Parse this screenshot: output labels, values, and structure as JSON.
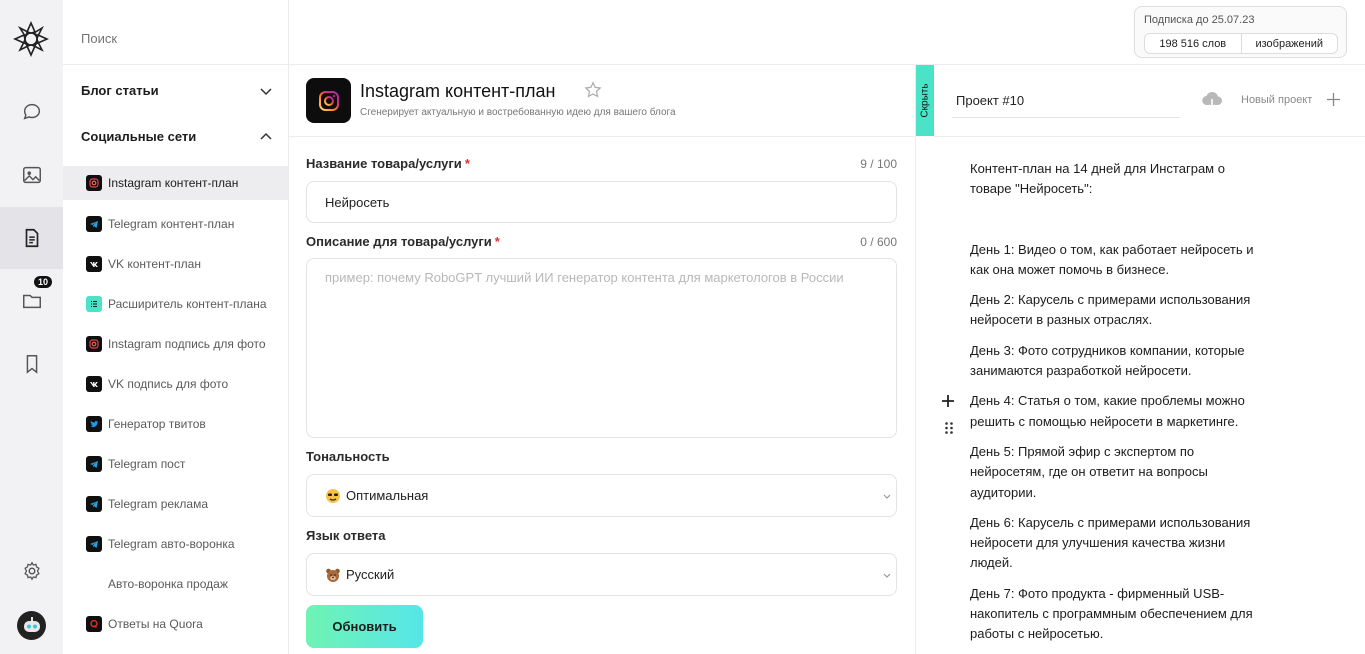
{
  "sidebar": {
    "search_placeholder": "Поиск",
    "groups": [
      {
        "label": "Блог статьи"
      },
      {
        "label": "Социальные сети"
      }
    ],
    "items": [
      {
        "label": "Instagram контент-план",
        "icon": "instagram-icon"
      },
      {
        "label": "Telegram контент-план",
        "icon": "telegram-icon"
      },
      {
        "label": "VK контент-план",
        "icon": "vk-icon"
      },
      {
        "label": "Расширитель контент-плана",
        "icon": "list-icon"
      },
      {
        "label": "Instagram подпись для фото",
        "icon": "instagram-icon"
      },
      {
        "label": "VK подпись для фото",
        "icon": "vk-icon"
      },
      {
        "label": "Генератор твитов",
        "icon": "twitter-icon"
      },
      {
        "label": "Telegram пост",
        "icon": "telegram-icon"
      },
      {
        "label": "Telegram реклама",
        "icon": "telegram-icon"
      },
      {
        "label": "Telegram авто-воронка",
        "icon": "telegram-icon"
      },
      {
        "label": "Авто-воронка продаж",
        "icon": ""
      },
      {
        "label": "Ответы на Quora",
        "icon": "quora-icon"
      }
    ]
  },
  "rail": {
    "folder_badge": "10"
  },
  "subscription": {
    "title": "Подписка до 25.07.23",
    "words": "198 516 слов",
    "images": "изображений"
  },
  "form": {
    "title": "Instagram контент-план",
    "subtitle": "Сгенерирует актуальную и востребованную идею для вашего блога",
    "product_label": "Название товара/услуги",
    "product_counter": "9 / 100",
    "product_value": "Нейросеть",
    "description_label": "Описание для товара/услуги",
    "description_counter": "0 / 600",
    "description_placeholder": "пример: почему RoboGPT лучший ИИ генератор контента для маркетологов в России",
    "tone_label": "Тональность",
    "tone_value": "Оптимальная",
    "language_label": "Язык ответа",
    "language_value": "Русский",
    "update_button": "Обновить",
    "required_mark": "*"
  },
  "output": {
    "hide_tab": "Скрыть",
    "project_name": "Проект #10",
    "new_project": "Новый проект",
    "intro": "Контент-план на 14 дней для Инстаграм о товаре \"Нейросеть\":",
    "days": [
      "День 1: Видео о том, как работает нейросеть и как она может помочь в бизнесе.",
      "День 2: Карусель с примерами использования нейросети в разных отраслях.",
      "День 3: Фото сотрудников компании, которые занимаются разработкой нейросети.",
      "День 4: Статья о том, какие проблемы можно решить с помощью нейросети в маркетинге.",
      "День 5: Прямой эфир с экспертом по нейросетям, где он ответит на вопросы аудитории.",
      "День 6: Карусель с примерами использования нейросети для улучшения качества жизни людей.",
      "День 7: Фото продукта - фирменный USB-накопитель с программным обеспечением для работы с нейросетью."
    ]
  },
  "colors": {
    "accent_teal": "#4be3c8",
    "button_gradient_start": "#6ff3b3",
    "button_gradient_end": "#56e6e8",
    "required": "#e03232"
  }
}
